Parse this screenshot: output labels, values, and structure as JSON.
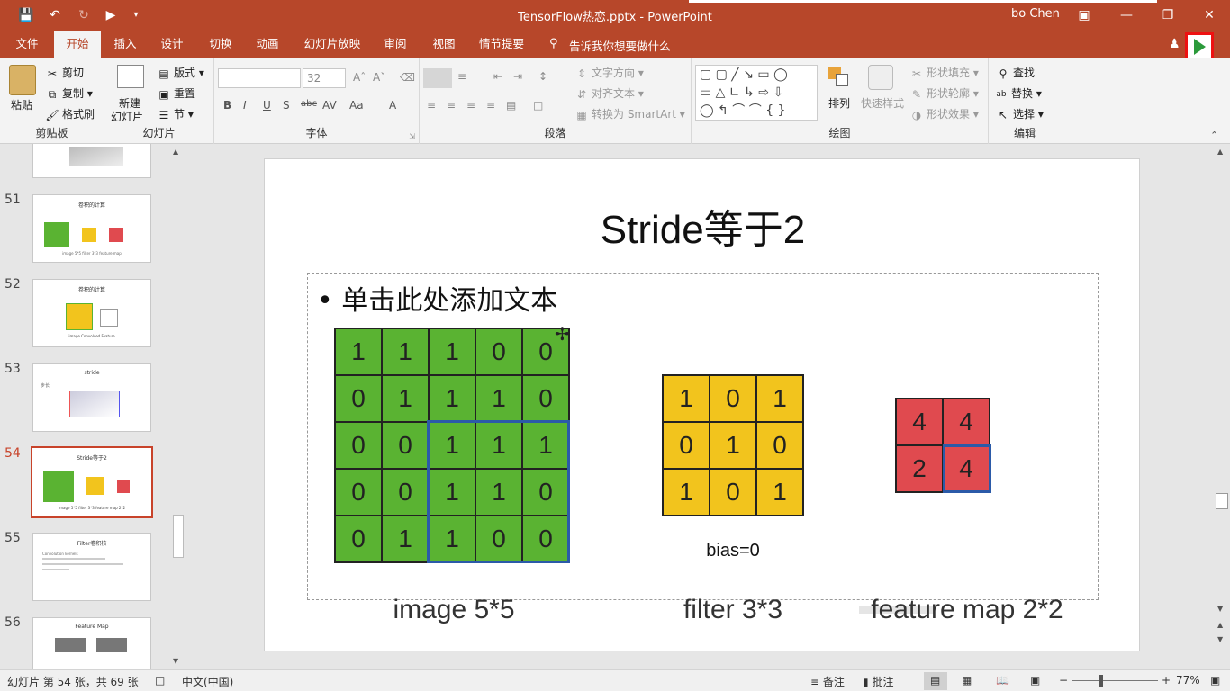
{
  "window": {
    "title": "TensorFlow热恋.pptx  -  PowerPoint",
    "user": "bo Chen"
  },
  "tabs": [
    "文件",
    "开始",
    "插入",
    "设计",
    "切换",
    "动画",
    "幻灯片放映",
    "审阅",
    "视图",
    "情节提要"
  ],
  "active_tab": "开始",
  "tell_me": "告诉我你想要做什么",
  "ribbon": {
    "clipboard": {
      "label": "剪贴板",
      "paste": "粘贴",
      "cut": "剪切",
      "copy": "复制",
      "format_painter": "格式刷"
    },
    "slides": {
      "label": "幻灯片",
      "new_slide_line1": "新建",
      "new_slide_line2": "幻灯片",
      "layout": "版式",
      "reset": "重置",
      "section": "节"
    },
    "font": {
      "label": "字体",
      "font_size": "32"
    },
    "paragraph": {
      "label": "段落",
      "text_direction": "文字方向",
      "align_text": "对齐文本",
      "smartart": "转换为 SmartArt"
    },
    "drawing": {
      "label": "绘图",
      "arrange": "排列",
      "quick_styles": "快速样式",
      "shape_fill": "形状填充",
      "shape_outline": "形状轮廓",
      "shape_effects": "形状效果"
    },
    "editing": {
      "label": "编辑",
      "find": "查找",
      "replace": "替换",
      "select": "选择"
    }
  },
  "slide_panel": {
    "slides": [
      {
        "num": "51",
        "title": "卷积的计算",
        "caption": "image 5*5    filter 3*3    feature map"
      },
      {
        "num": "52",
        "title": "卷积的计算",
        "caption": "image    Convolved Feature"
      },
      {
        "num": "53",
        "title": "stride",
        "caption": "步长"
      },
      {
        "num": "54",
        "title": "Stride等于2",
        "caption": "image 5*5    filter 3*3    feature map 2*2"
      },
      {
        "num": "55",
        "title": "Filter卷积核",
        "caption": "Convolution kernels"
      },
      {
        "num": "56",
        "title": "Feature Map",
        "caption": ""
      }
    ],
    "selected": "54"
  },
  "slide": {
    "title": "Stride等于2",
    "bullet": "单击此处添加文本",
    "image_grid": [
      [
        1,
        1,
        1,
        0,
        0
      ],
      [
        0,
        1,
        1,
        1,
        0
      ],
      [
        0,
        0,
        1,
        1,
        1
      ],
      [
        0,
        0,
        1,
        1,
        0
      ],
      [
        0,
        1,
        1,
        0,
        0
      ]
    ],
    "filter_grid": [
      [
        1,
        0,
        1
      ],
      [
        0,
        1,
        0
      ],
      [
        1,
        0,
        1
      ]
    ],
    "feature_grid": [
      [
        4,
        4
      ],
      [
        2,
        4
      ]
    ],
    "bias": "bias=0",
    "image_caption": "image 5*5",
    "filter_caption": "filter 3*3",
    "feature_caption": "feature map 2*2",
    "colors": {
      "image": "#5ab332",
      "filter": "#f2c41d",
      "feature": "#e04a4f",
      "highlight": "#2b5aa8",
      "accent": "#b7472a"
    }
  },
  "status": {
    "slide_info": "幻灯片 第 54 张，共 69 张",
    "language": "中文(中国)",
    "notes": "备注",
    "comments": "批注",
    "zoom": "77%"
  }
}
